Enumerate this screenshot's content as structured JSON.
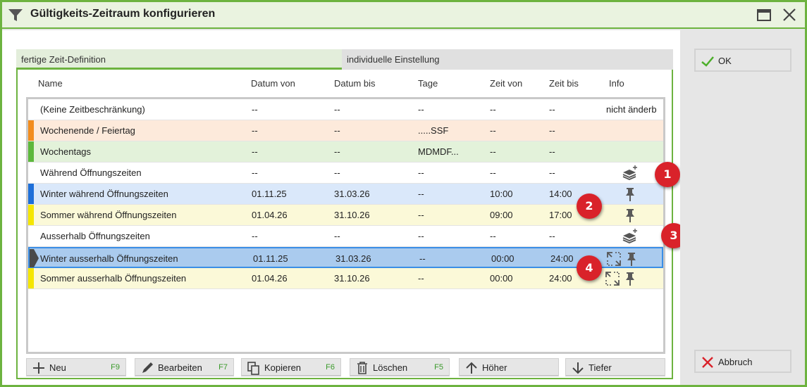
{
  "window": {
    "title": "Gültigkeits-Zeitraum konfigurieren"
  },
  "tabs": [
    {
      "label": "fertige Zeit-Definition",
      "active": true
    },
    {
      "label": "individuelle Einstellung",
      "active": false
    }
  ],
  "columns": [
    "Name",
    "Datum von",
    "Datum bis",
    "Tage",
    "Zeit von",
    "Zeit bis",
    "Info"
  ],
  "rows": [
    {
      "name": "(Keine Zeitbeschränkung)",
      "datum_von": "--",
      "datum_bis": "--",
      "tage": "--",
      "zeit_von": "--",
      "zeit_bis": "--",
      "info": "nicht änderb",
      "color": "",
      "bg": "#ffffff",
      "icons": []
    },
    {
      "name": "Wochenende / Feiertag",
      "datum_von": "--",
      "datum_bis": "--",
      "tage": ".....SSF",
      "zeit_von": "--",
      "zeit_bis": "--",
      "info": "",
      "color": "#f28c1e",
      "bg": "#fdeadb",
      "icons": []
    },
    {
      "name": "Wochentags",
      "datum_von": "--",
      "datum_bis": "--",
      "tage": "MDMDF...",
      "zeit_von": "--",
      "zeit_bis": "--",
      "info": "",
      "color": "#5cb83c",
      "bg": "#e3f2da",
      "icons": []
    },
    {
      "name": "Während Öffnungszeiten",
      "datum_von": "--",
      "datum_bis": "--",
      "tage": "--",
      "zeit_von": "--",
      "zeit_bis": "--",
      "info": "",
      "color": "",
      "bg": "#ffffff",
      "icons": [
        "layers-add-icon"
      ]
    },
    {
      "name": "Winter während Öffnungszeiten",
      "datum_von": "01.11.25",
      "datum_bis": "31.03.26",
      "tage": "--",
      "zeit_von": "10:00",
      "zeit_bis": "14:00",
      "info": "",
      "color": "#1e6fd9",
      "bg": "#dae8fa",
      "icons": [
        "pin-icon"
      ]
    },
    {
      "name": "Sommer während Öffnungszeiten",
      "datum_von": "01.04.26",
      "datum_bis": "31.10.26",
      "tage": "--",
      "zeit_von": "09:00",
      "zeit_bis": "17:00",
      "info": "",
      "color": "#f5e600",
      "bg": "#fbf9d8",
      "icons": [
        "pin-icon"
      ]
    },
    {
      "name": "Ausserhalb Öffnungszeiten",
      "datum_von": "--",
      "datum_bis": "--",
      "tage": "--",
      "zeit_von": "--",
      "zeit_bis": "--",
      "info": "",
      "color": "",
      "bg": "#ffffff",
      "icons": [
        "layers-add-icon"
      ]
    },
    {
      "name": "Winter ausserhalb Öffnungszeiten",
      "datum_von": "01.11.25",
      "datum_bis": "31.03.26",
      "tage": "--",
      "zeit_von": "00:00",
      "zeit_bis": "24:00",
      "info": "",
      "color": "#1e6fd9",
      "bg": "#aacbee",
      "icons": [
        "cycle-icon",
        "pin-icon"
      ],
      "selected": true
    },
    {
      "name": "Sommer ausserhalb Öffnungszeiten",
      "datum_von": "01.04.26",
      "datum_bis": "31.10.26",
      "tage": "--",
      "zeit_von": "00:00",
      "zeit_bis": "24:00",
      "info": "",
      "color": "#f5e600",
      "bg": "#fbf9d8",
      "icons": [
        "cycle-icon",
        "pin-icon"
      ]
    }
  ],
  "badges": [
    "1",
    "2",
    "3",
    "4"
  ],
  "buttons": {
    "neu": {
      "label": "Neu",
      "key": "F9"
    },
    "bearbeiten": {
      "label": "Bearbeiten",
      "key": "F7"
    },
    "kopieren": {
      "label": "Kopieren",
      "key": "F6"
    },
    "loeschen": {
      "label": "Löschen",
      "key": "F5"
    },
    "hoeher": {
      "label": "Höher"
    },
    "tiefer": {
      "label": "Tiefer"
    },
    "ok": {
      "label": "OK"
    },
    "abbruch": {
      "label": "Abbruch"
    }
  },
  "colors": {
    "accent": "#6db33f",
    "selection": "#3a8ee6",
    "badge": "#d9222a",
    "shortcut": "#3a9a2a"
  }
}
